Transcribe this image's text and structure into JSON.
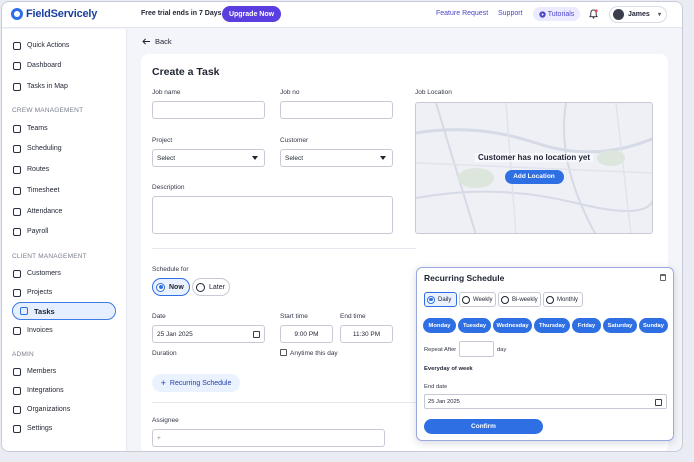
{
  "brand": {
    "name": "FieldServicely",
    "accent": "#2f6fe4",
    "purple": "#5a3ee0"
  },
  "topbar": {
    "trial_text": "Free trial ends in 7 Days",
    "upgrade_label": "Upgrade Now",
    "feature_request": "Feature Request",
    "support": "Support",
    "tutorials": "Tutorials",
    "user_name": "James"
  },
  "sidebar": {
    "items_top": [
      "Quick Actions",
      "Dashboard",
      "Tasks in Map"
    ],
    "section_crew": "CREW MANAGEMENT",
    "items_crew": [
      "Teams",
      "Scheduling",
      "Routes",
      "Timesheet",
      "Attendance",
      "Payroll"
    ],
    "section_client": "CLIENT MANAGEMENT",
    "items_client": [
      "Customers",
      "Projects",
      "Tasks",
      "Invoices"
    ],
    "section_admin": "ADMIN",
    "items_admin": [
      "Members",
      "Integrations",
      "Organizations",
      "Settings"
    ]
  },
  "page": {
    "back_label": "Back",
    "title": "Create a Task",
    "job_name_label": "Job name",
    "job_no_label": "Job no",
    "job_location_label": "Job Location",
    "project_label": "Project",
    "project_value": "Select",
    "customer_label": "Customer",
    "customer_value": "Select",
    "description_label": "Description",
    "map_message": "Customer has no location yet",
    "add_location": "Add Location",
    "schedule_for_label": "Schedule for",
    "schedule_now": "Now",
    "schedule_later": "Later",
    "date_label": "Date",
    "date_value": "25 Jan 2025",
    "start_time_label": "Start time",
    "start_time_value": "9:00 PM",
    "end_time_label": "End time",
    "end_time_value": "11:30 PM",
    "duration_label": "Duration",
    "anytime_label": "Anytime this day",
    "recurring_button": "Recurring Schedule",
    "assignee_label": "Assignee",
    "assignee_placeholder": "+"
  },
  "recurring": {
    "title": "Recurring Schedule",
    "frequencies": [
      "Daily",
      "Weekly",
      "Bi-weekly",
      "Monthly"
    ],
    "selected_frequency": "Daily",
    "days": [
      "Monday",
      "Tuesday",
      "Wednesday",
      "Thursday",
      "Friday",
      "Saturday",
      "Sunday"
    ],
    "repeat_after_label": "Repeat After",
    "repeat_after_value": "",
    "repeat_unit": "day",
    "summary": "Everyday of week",
    "end_date_label": "End date",
    "end_date_value": "25 Jan 2025",
    "confirm_label": "Confirm"
  }
}
